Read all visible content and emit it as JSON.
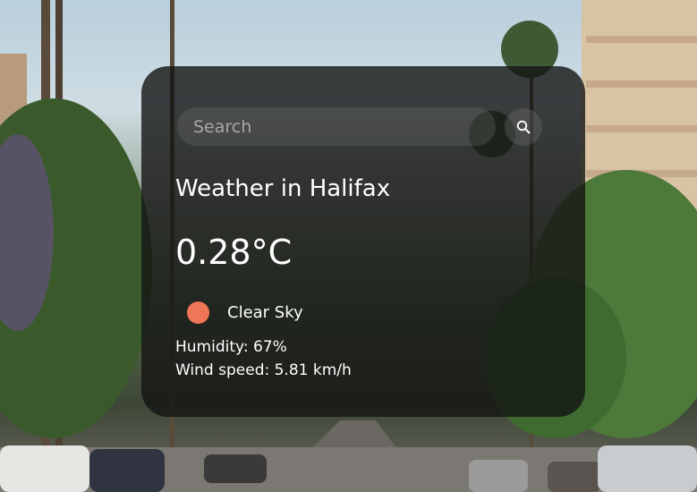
{
  "search": {
    "placeholder": "Search",
    "value": "",
    "button_icon": "search-icon"
  },
  "weather": {
    "title": "Weather in Halifax",
    "temperature": "0.28°C",
    "description": "Clear Sky",
    "icon": "sun-icon",
    "humidity": "Humidity: 67%",
    "wind_speed": "Wind speed: 5.81 km/h"
  },
  "colors": {
    "sun": "#ef7656",
    "card_background": "#141414",
    "text": "#ffffff"
  }
}
